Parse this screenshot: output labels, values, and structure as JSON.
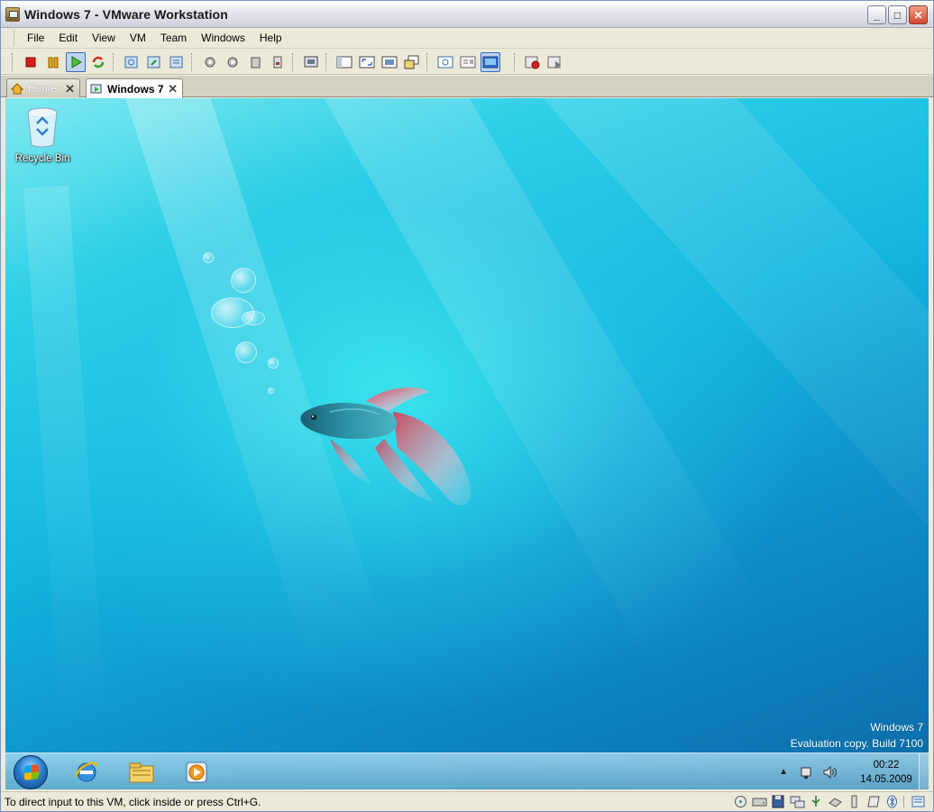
{
  "window": {
    "title": "Windows 7 - VMware Workstation"
  },
  "window_controls": {
    "minimize": "_",
    "maximize": "□",
    "close": "✕"
  },
  "menu": [
    "File",
    "Edit",
    "View",
    "VM",
    "Team",
    "Windows",
    "Help"
  ],
  "tabs": [
    {
      "label": "Home",
      "close": "✕",
      "icon": "home-icon"
    },
    {
      "label": "Windows 7",
      "close": "✕",
      "icon": "vm-icon",
      "active": true
    }
  ],
  "desktop": {
    "icons": [
      {
        "label": "Recycle Bin",
        "icon": "recycle-bin-icon"
      }
    ],
    "watermark_line1": "Windows 7",
    "watermark_line2": "Evaluation copy. Build 7100"
  },
  "taskbar": {
    "pinned": [
      "internet-explorer-icon",
      "explorer-folder-icon",
      "media-player-icon"
    ],
    "clock_time": "00:22",
    "clock_date": "14.05.2009"
  },
  "statusbar": {
    "message": "To direct input to this VM, click inside or press Ctrl+G."
  },
  "colors": {
    "accent": "#316ac5",
    "desktop_top": "#7fe9f0",
    "desktop_bottom": "#0b6aa8"
  }
}
